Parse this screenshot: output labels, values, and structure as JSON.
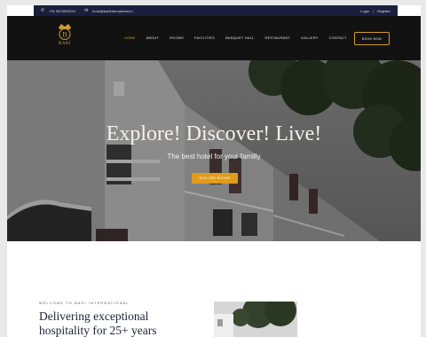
{
  "topbar": {
    "phone": "+91 9876543210",
    "email": "book@bariinternational.in",
    "login": "Login",
    "separator": "|",
    "register": "Register"
  },
  "brand": {
    "monogram": "B",
    "name": "BARI"
  },
  "nav": {
    "items": [
      "HOME",
      "ABOUT",
      "ROOMS",
      "FACILITIES",
      "BANQUET HALL",
      "RESTAURANT",
      "GALLERY",
      "CONTACT"
    ],
    "active_index": 0,
    "book_label": "BOOK NOW"
  },
  "hero": {
    "title": "Explore! Discover! Live!",
    "subtitle": "The best hotel for your familly",
    "button": "EXPLORE ROOMS"
  },
  "intro": {
    "eyebrow": "WELCOME TO BARI INTERNATIONAL",
    "heading": "Delivering exceptional hospitality for 25+ years"
  },
  "colors": {
    "accent": "#e09c1a",
    "topbar": "#1a1f3d",
    "nav": "#121212",
    "heading": "#1d2236"
  },
  "icons": {
    "phone": "phone-icon",
    "email": "email-icon",
    "crown": "crown-logo-icon"
  }
}
